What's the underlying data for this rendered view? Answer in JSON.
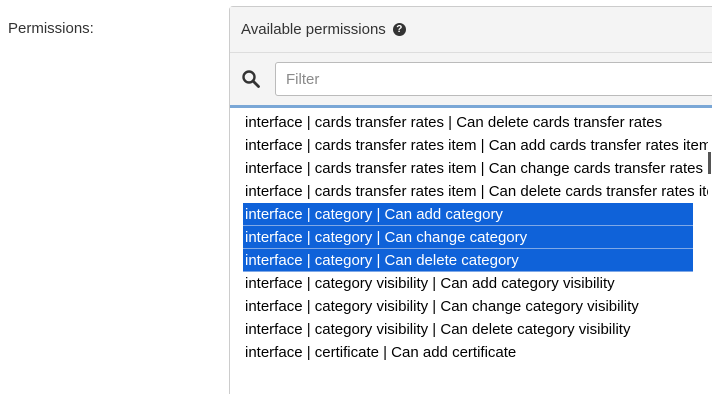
{
  "field": {
    "label": "Permissions:"
  },
  "selector": {
    "title": "Available permissions",
    "help_icon": "question-circle-icon",
    "search_icon": "search-icon",
    "filter_placeholder": "Filter",
    "filter_value": "",
    "options": [
      {
        "text": "interface | cards transfer rates | Can delete cards transfer rates",
        "selected": false
      },
      {
        "text": "interface | cards transfer rates item | Can add cards transfer rates item",
        "selected": false
      },
      {
        "text": "interface | cards transfer rates item | Can change cards transfer rates item",
        "selected": false
      },
      {
        "text": "interface | cards transfer rates item | Can delete cards transfer rates item",
        "selected": false
      },
      {
        "text": "interface | category | Can add category",
        "selected": true
      },
      {
        "text": "interface | category | Can change category",
        "selected": true
      },
      {
        "text": "interface | category | Can delete category",
        "selected": true
      },
      {
        "text": "interface | category visibility | Can add category visibility",
        "selected": false
      },
      {
        "text": "interface | category visibility | Can change category visibility",
        "selected": false
      },
      {
        "text": "interface | category visibility | Can delete category visibility",
        "selected": false
      },
      {
        "text": "interface | certificate | Can add certificate",
        "selected": false
      }
    ]
  },
  "colors": {
    "selected_bg": "#0f62d9",
    "header_bg": "#f4f4f4"
  }
}
